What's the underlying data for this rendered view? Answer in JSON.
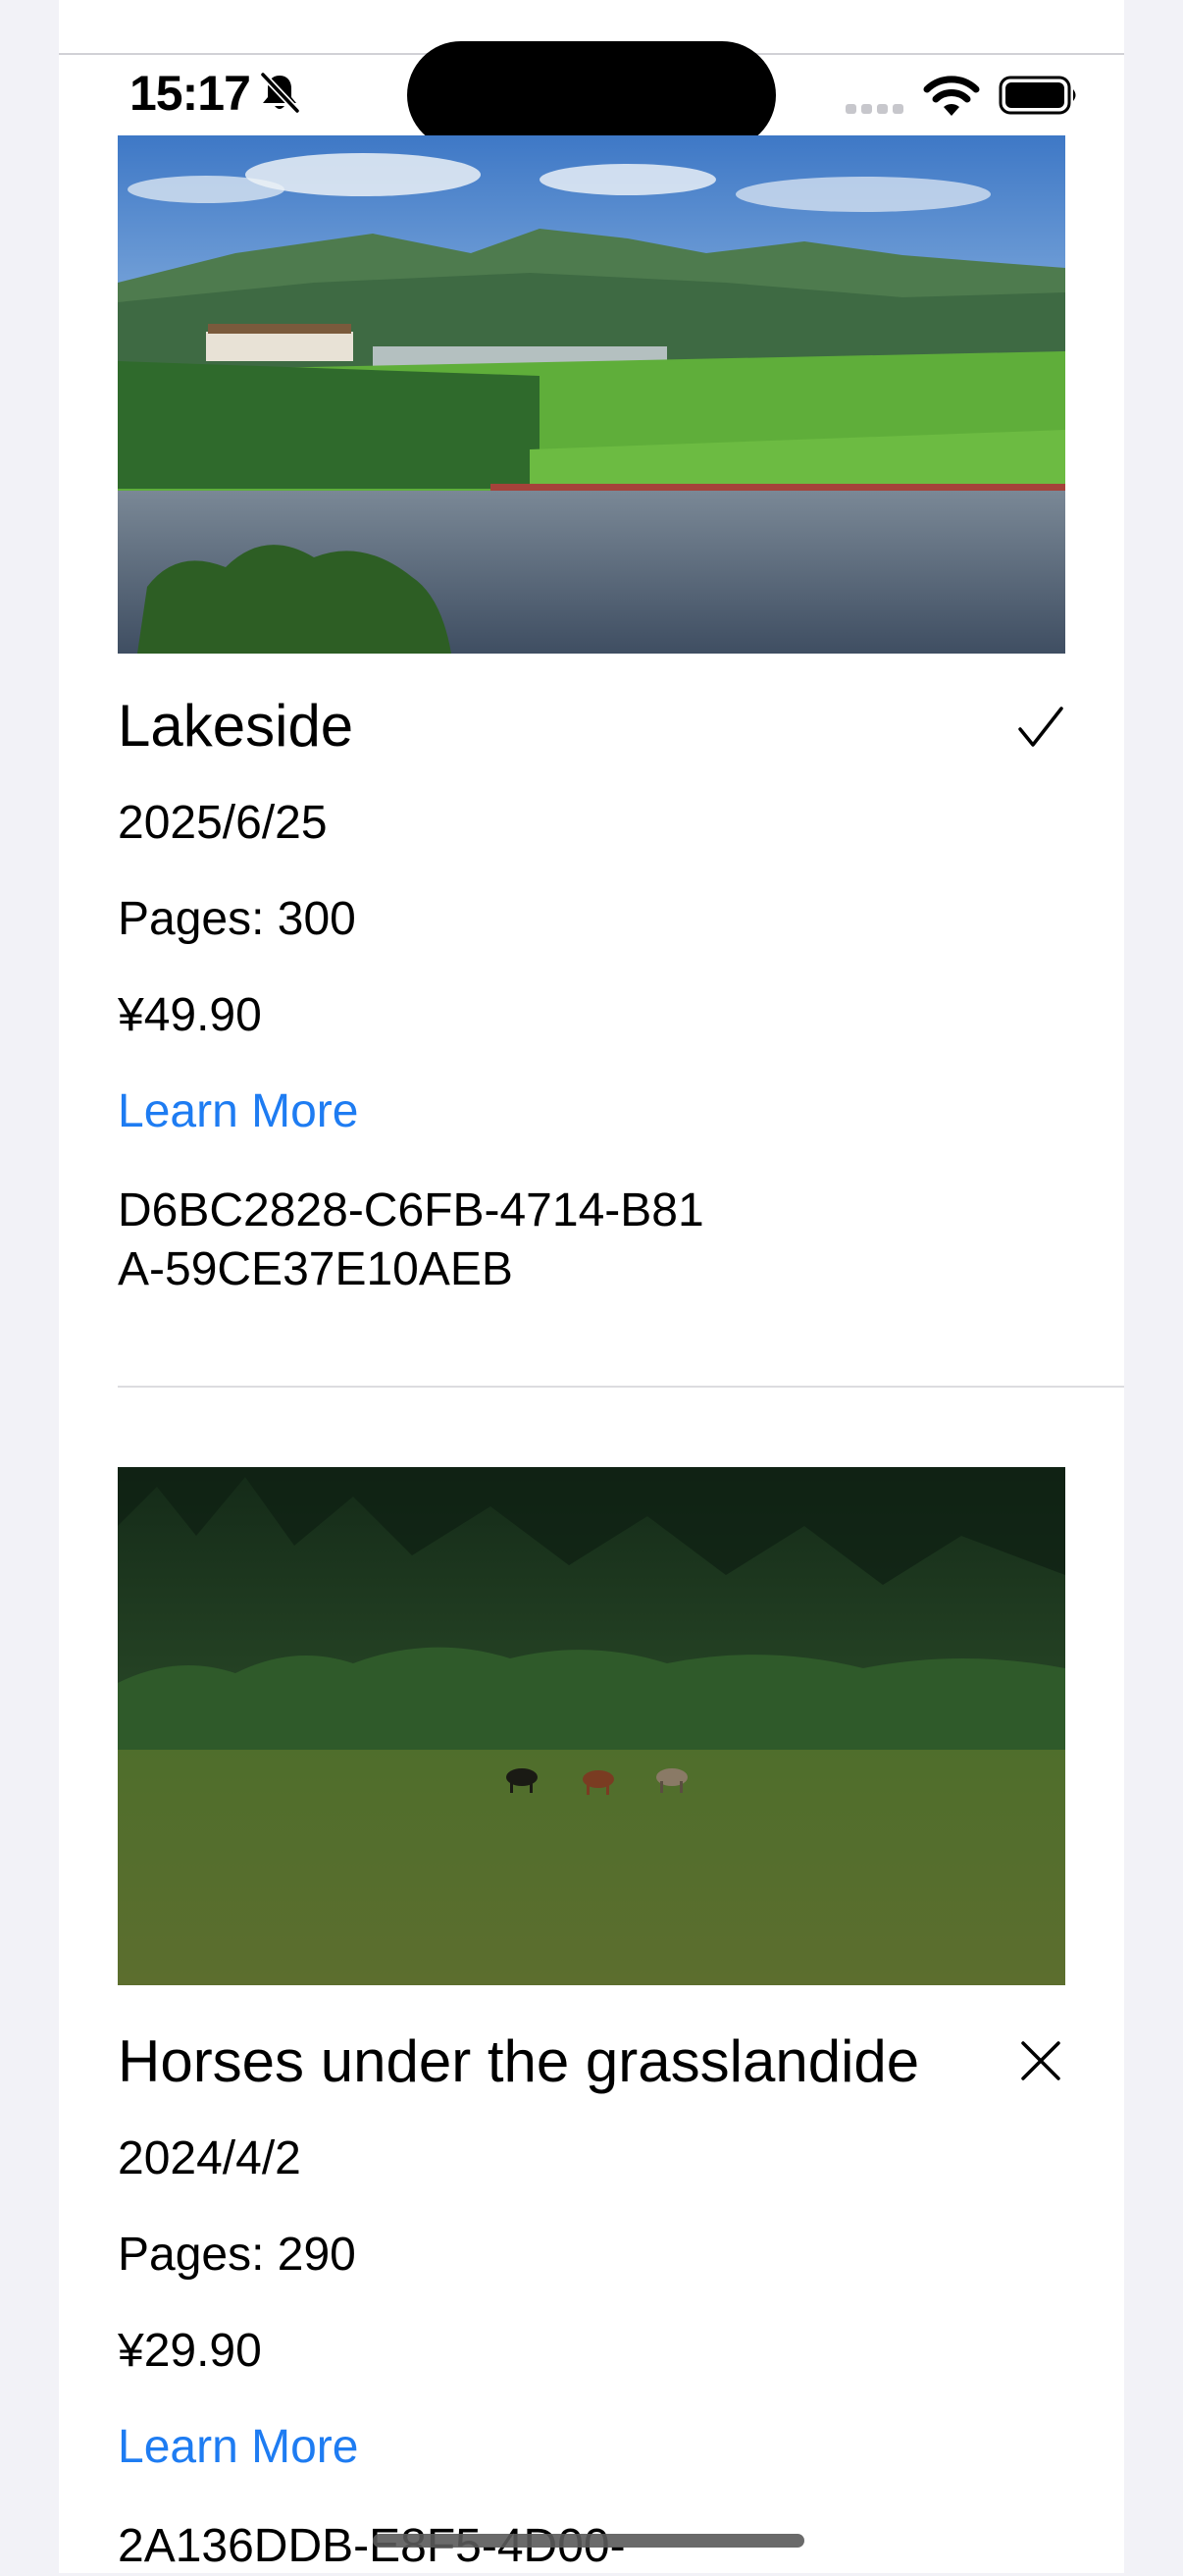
{
  "status_bar": {
    "time": "15:17",
    "icons": [
      "bell-slash-icon",
      "cellular-signal-icon",
      "wifi-icon",
      "battery-icon"
    ]
  },
  "colors": {
    "link": "#1E7CF2",
    "background": "#F2F2F7",
    "card": "#FFFFFF"
  },
  "items": [
    {
      "image": "lakeside-landscape-photo",
      "title": "Lakeside",
      "status_icon": "checkmark-icon",
      "date": "2025/6/25",
      "pages": "Pages: 300",
      "price": "¥49.90",
      "link": "Learn More",
      "id": "D6BC2828-C6FB-4714-B81A-59CE37E10AEB"
    },
    {
      "image": "horses-grassland-photo",
      "title": "Horses under the grasslandide",
      "status_icon": "xmark-icon",
      "date": "2024/4/2",
      "pages": "Pages: 290",
      "price": "¥29.90",
      "link": "Learn More",
      "id": "2A136DDB-E8F5-4D00-"
    }
  ]
}
